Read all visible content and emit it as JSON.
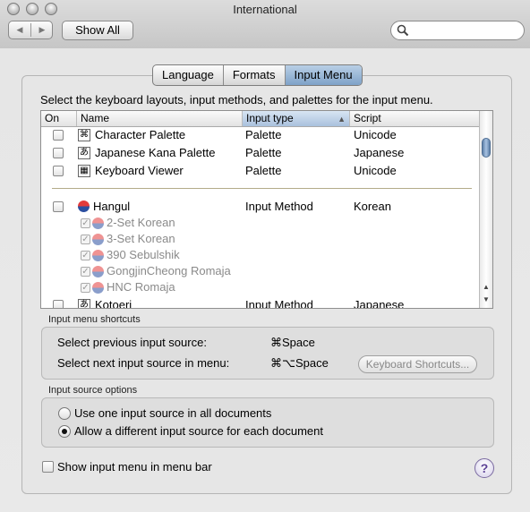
{
  "window": {
    "title": "International"
  },
  "toolbar": {
    "back_icon": "left-triangle",
    "forward_icon": "right-triangle",
    "show_all_label": "Show All",
    "search_value": "",
    "search_icon": "magnifier"
  },
  "tabs": [
    {
      "label": "Language",
      "selected": false
    },
    {
      "label": "Formats",
      "selected": false
    },
    {
      "label": "Input Menu",
      "selected": true
    }
  ],
  "description": "Select the keyboard layouts, input methods, and palettes for the input menu.",
  "table": {
    "columns": [
      "On",
      "Name",
      "Input type",
      "Script"
    ],
    "sorted_column": "Input type",
    "rows": [
      {
        "checked": false,
        "name": "Character Palette",
        "type": "Palette",
        "script": "Unicode",
        "icon": "character-palette-icon",
        "icon_glyph": "⌘"
      },
      {
        "checked": false,
        "name": "Japanese Kana Palette",
        "type": "Palette",
        "script": "Japanese",
        "icon": "kana-palette-icon",
        "icon_glyph": "あ"
      },
      {
        "checked": false,
        "name": "Keyboard Viewer",
        "type": "Palette",
        "script": "Unicode",
        "icon": "keyboard-viewer-icon",
        "icon_glyph": "▦"
      },
      {
        "checked": false,
        "name": "Hangul",
        "type": "Input Method",
        "script": "Korean",
        "icon": "korean-flag-icon"
      },
      {
        "checked": true,
        "name": "2-Set Korean",
        "sub": true
      },
      {
        "checked": true,
        "name": "3-Set Korean",
        "sub": true
      },
      {
        "checked": true,
        "name": "390 Sebulshik",
        "sub": true
      },
      {
        "checked": true,
        "name": "GongjinCheong Romaja",
        "sub": true
      },
      {
        "checked": true,
        "name": "HNC Romaja",
        "sub": true
      },
      {
        "checked": false,
        "name": "Kotoeri",
        "type": "Input Method",
        "script": "Japanese",
        "icon": "kotoeri-icon",
        "icon_glyph": "あ"
      }
    ]
  },
  "shortcuts": {
    "label": "Input menu shortcuts",
    "prev_label": "Select previous input source:",
    "prev_key": "⌘Space",
    "next_label": "Select next input source in menu:",
    "next_key": "⌘⌥Space",
    "keyboard_button": "Keyboard Shortcuts..."
  },
  "options": {
    "label": "Input source options",
    "radio1": "Use one input source in all documents",
    "radio2": "Allow a different input source for each document",
    "selected": 2
  },
  "show_menu_label": "Show input menu in menu bar",
  "show_menu_checked": false,
  "help_label": "?"
}
